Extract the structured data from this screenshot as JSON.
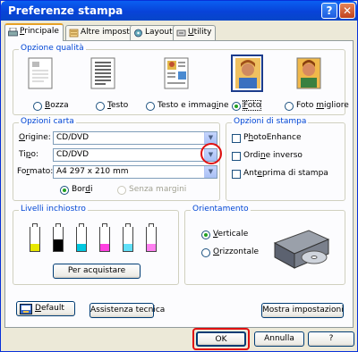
{
  "window": {
    "title": "Preferenze stampa",
    "help_glyph": "?",
    "close_glyph": "✕"
  },
  "tabs": [
    {
      "label": "Principale",
      "mnemonic": "P",
      "rest": "rincipale",
      "active": true,
      "icon": "printer-icon"
    },
    {
      "label": "Altre impost.",
      "active": false,
      "icon": "settings-icon"
    },
    {
      "label": "Layout",
      "active": false,
      "icon": "layout-icon"
    },
    {
      "label": "Utility",
      "mnemonic": "U",
      "rest": "tility",
      "active": false,
      "icon": "utility-icon"
    }
  ],
  "quality": {
    "title": "Opzione qualità",
    "options": [
      {
        "pre": "",
        "mn": "B",
        "post": "ozza",
        "label": "Bozza",
        "selected": false,
        "icon": "draft-page-icon"
      },
      {
        "pre": "",
        "mn": "T",
        "post": "esto",
        "label": "Testo",
        "selected": false,
        "icon": "text-page-icon"
      },
      {
        "pre": "Testo e immag",
        "mn": "i",
        "post": "ne",
        "label": "Testo e immagine",
        "selected": false,
        "icon": "text-image-page-icon"
      },
      {
        "pre": "",
        "mn": "F",
        "post": "oto",
        "label": "Foto",
        "selected": true,
        "icon": "photo-icon"
      },
      {
        "pre": "Foto ",
        "mn": "m",
        "post": "igliore",
        "label": "Foto migliore",
        "selected": false,
        "icon": "best-photo-icon"
      }
    ]
  },
  "paper": {
    "title": "Opzioni carta",
    "origine_label": "Origine:",
    "origine_mn": "O",
    "origine_rest": "rigine:",
    "origine_value": "CD/DVD",
    "tipo_label": "Tipo:",
    "tipo_pre": "Ti",
    "tipo_mn": "p",
    "tipo_post": "o:",
    "tipo_value": "CD/DVD",
    "formato_label": "Formato:",
    "formato_pre": "Fo",
    "formato_mn": "r",
    "formato_post": "mato:",
    "formato_value": "A4 297 x 210 mm",
    "bordi_label": "Bordi",
    "bordi_pre": "Bor",
    "bordi_mn": "d",
    "bordi_post": "i",
    "bordi_selected": true,
    "senza_label": "Senza margini"
  },
  "print_options": {
    "title": "Opzioni di stampa",
    "items": [
      {
        "label": "PhotoEnhance",
        "pre": "P",
        "mn": "h",
        "post": "otoEnhance",
        "checked": false
      },
      {
        "label": "Ordine inverso",
        "pre": "Ordi",
        "mn": "n",
        "post": "e inverso",
        "checked": false
      },
      {
        "label": "Anteprima di stampa",
        "pre": "Ant",
        "mn": "e",
        "post": "prima di stampa",
        "checked": false
      }
    ]
  },
  "ink": {
    "title": "Livelli inchiostro",
    "cartridges": [
      {
        "color": "#e8e800",
        "level": 0.3
      },
      {
        "color": "#000000",
        "level": 0.5
      },
      {
        "color": "#00c8e0",
        "level": 0.3
      },
      {
        "color": "#ff40e0",
        "level": 0.3
      },
      {
        "color": "#60e0f8",
        "level": 0.3
      },
      {
        "color": "#ff80f0",
        "level": 0.3
      }
    ],
    "button_label": "Per acquistare"
  },
  "orientation": {
    "title": "Orientamento",
    "verticale_label": "Verticale",
    "verticale_mn": "V",
    "verticale_rest": "erticale",
    "verticale_selected": true,
    "orizzontale_label": "Orizzontale",
    "orizzontale_mn": "O",
    "orizzontale_rest": "rizzontale",
    "orizzontale_selected": false
  },
  "bottom_buttons": {
    "default_label": "Default",
    "default_mn": "D",
    "default_rest": "efault",
    "assistenza_label": "Assistenza tecnica",
    "mostra_label": "Mostra impostazioni"
  },
  "dialog_buttons": {
    "ok_label": "OK",
    "annulla_label": "Annulla",
    "help_label": "?"
  },
  "colors": {
    "accent_title": "#0046d5",
    "highlight": "#e01010",
    "radio_dot": "#21a121"
  }
}
